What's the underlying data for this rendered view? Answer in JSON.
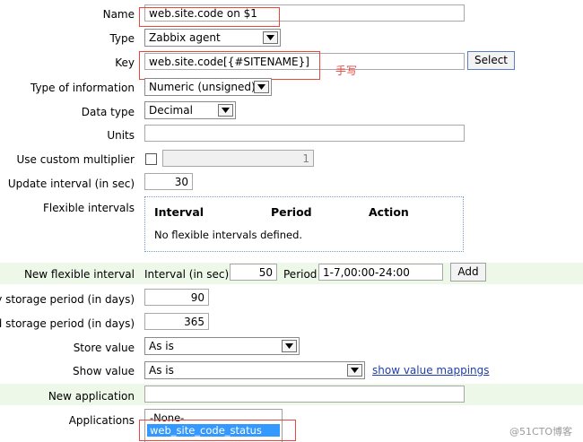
{
  "form": {
    "name": {
      "label": "Name",
      "value": "web.site.code on $1"
    },
    "type": {
      "label": "Type",
      "value": "Zabbix agent"
    },
    "key": {
      "label": "Key",
      "value": "web.site.code[{#SITENAME}]",
      "select_button": "Select",
      "annotation": "手写"
    },
    "type_of_information": {
      "label": "Type of information",
      "value": "Numeric (unsigned)"
    },
    "data_type": {
      "label": "Data type",
      "value": "Decimal"
    },
    "units": {
      "label": "Units",
      "value": ""
    },
    "custom_multiplier": {
      "label": "Use custom multiplier",
      "checked": false,
      "value": "1"
    },
    "update_interval": {
      "label": "Update interval (in sec)",
      "value": "30"
    },
    "flexible_intervals": {
      "label": "Flexible intervals",
      "columns": [
        "Interval",
        "Period",
        "Action"
      ],
      "empty_text": "No flexible intervals defined."
    },
    "new_flexible_interval": {
      "label": "New flexible interval",
      "interval_label": "Interval (in sec)",
      "interval_value": "50",
      "period_label": "Period",
      "period_value": "1-7,00:00-24:00",
      "add_button": "Add"
    },
    "history_storage": {
      "label": "ry storage period (in days)",
      "value": "90"
    },
    "trend_storage": {
      "label": "nd storage period (in days)",
      "value": "365"
    },
    "store_value": {
      "label": "Store value",
      "value": "As is"
    },
    "show_value": {
      "label": "Show value",
      "value": "As is",
      "link": "show value mappings"
    },
    "new_application": {
      "label": "New application",
      "value": ""
    },
    "applications": {
      "label": "Applications",
      "options": [
        "-None-",
        "web_site_code_status"
      ],
      "selected": "web_site_code_status"
    }
  },
  "watermark": "@51CTO博客",
  "colors": {
    "highlight_band": "#eef8e8",
    "annotation_red": "#e8473e",
    "selected_option": "#3399ff",
    "link": "#1f3fa8"
  }
}
